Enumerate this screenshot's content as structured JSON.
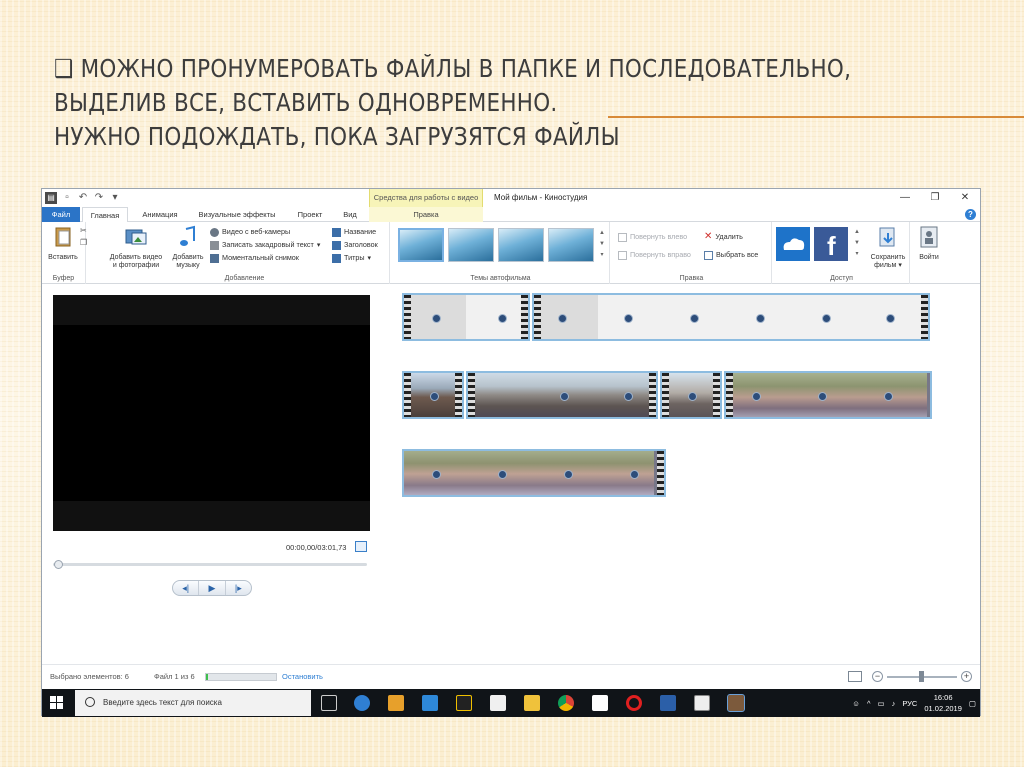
{
  "slide": {
    "title_lines": [
      "❑ Можно пронумеровать файлы в папке и последовательно,",
      "выделив все, вставить одновременно.",
      "Нужно подождать, пока загрузятся файлы"
    ]
  },
  "app": {
    "window_title": "Мой фильм - Киностудия",
    "context_tools_label": "Средства для работы с видео",
    "tabs": {
      "file": "Файл",
      "home": "Главная",
      "animation": "Анимация",
      "visual_effects": "Визуальные эффекты",
      "project": "Проект",
      "view": "Вид",
      "edit": "Правка"
    },
    "ribbon": {
      "clipboard": {
        "paste": "Вставить",
        "group": "Буфер"
      },
      "add": {
        "add_video_l1": "Добавить видео",
        "add_video_l2": "и фотографии",
        "add_music_l1": "Добавить",
        "add_music_l2": "музыку",
        "webcam": "Видео с веб-камеры",
        "record_narration": "Записать закадровый текст",
        "snapshot": "Моментальный снимок",
        "title": "Название",
        "caption": "Заголовок",
        "credits": "Титры",
        "group": "Добавление"
      },
      "themes": {
        "group": "Темы автофильма"
      },
      "editing": {
        "rotate_left": "Повернуть влево",
        "rotate_right": "Повернуть вправо",
        "delete": "Удалить",
        "select_all": "Выбрать все",
        "group": "Правка"
      },
      "share": {
        "save_movie_l1": "Сохранить",
        "save_movie_l2": "фильм",
        "signin": "Войти",
        "group": "Доступ"
      }
    },
    "preview": {
      "timecode": "00:00,00/03:01,73"
    },
    "status": {
      "selected": "Выбрано элементов: 6",
      "file_progress": "Файл 1 из 6",
      "progress_fraction": 0.03,
      "stop": "Остановить",
      "zoom_fraction": 0.45
    }
  },
  "taskbar": {
    "search_placeholder": "Введите здесь текст для поиска",
    "language": "РУС",
    "time": "16:06",
    "date": "01.02.2019"
  },
  "colors": {
    "accent": "#2b74c7",
    "title_text": "#3d3d3d",
    "rule": "#d88a38",
    "clip_border": "#8dbce0",
    "progress": "#3fbf4d"
  }
}
